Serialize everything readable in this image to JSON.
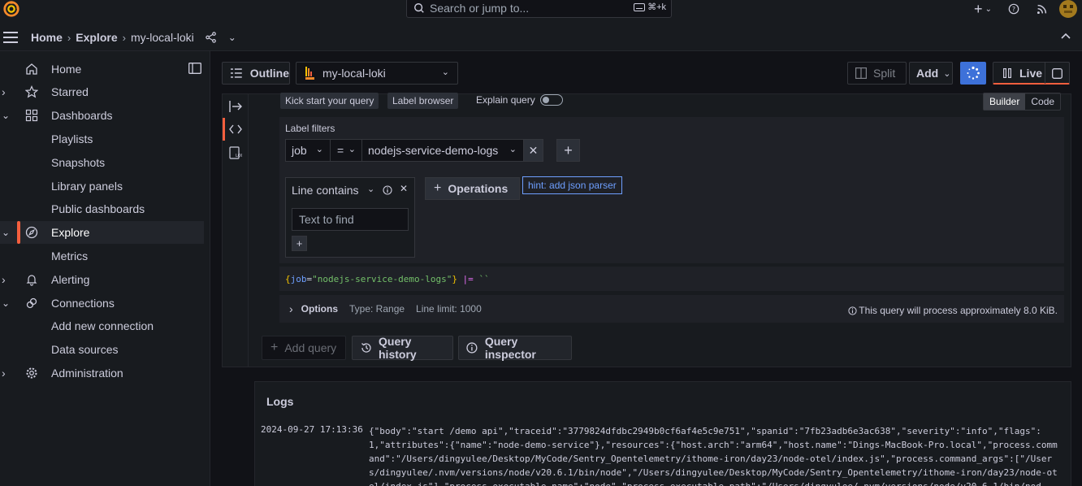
{
  "topbar": {
    "search_placeholder": "Search or jump to...",
    "search_shortcut": "⌘+k"
  },
  "breadcrumb": {
    "items": [
      "Home",
      "Explore",
      "my-local-loki"
    ]
  },
  "sidebar": {
    "items": [
      {
        "label": "Home",
        "icon": "home-icon"
      },
      {
        "label": "Starred",
        "icon": "star-icon"
      },
      {
        "label": "Dashboards",
        "icon": "apps-icon"
      },
      {
        "label": "Playlists"
      },
      {
        "label": "Snapshots"
      },
      {
        "label": "Library panels"
      },
      {
        "label": "Public dashboards"
      },
      {
        "label": "Explore",
        "icon": "compass-icon"
      },
      {
        "label": "Metrics"
      },
      {
        "label": "Alerting",
        "icon": "bell-icon"
      },
      {
        "label": "Connections",
        "icon": "link-icon"
      },
      {
        "label": "Add new connection"
      },
      {
        "label": "Data sources"
      },
      {
        "label": "Administration",
        "icon": "cog-icon"
      }
    ]
  },
  "toolbar": {
    "outline_label": "Outline",
    "datasource": "my-local-loki",
    "split_label": "Split",
    "add_label": "Add",
    "live_label": "Live"
  },
  "query": {
    "kick_start": "Kick start your query",
    "label_browser": "Label browser",
    "explain_query": "Explain query",
    "mode_builder": "Builder",
    "mode_code": "Code",
    "label_filters_title": "Label filters",
    "filter_label": "job",
    "filter_op": "=",
    "filter_value": "nodejs-service-demo-logs",
    "operation_name": "Line contains",
    "text_placeholder": "Text to find",
    "operations_label": "Operations",
    "hint": "hint: add json parser",
    "code_open": "{",
    "code_key": "job",
    "code_eq": "=",
    "code_val": "\"nodejs-service-demo-logs\"",
    "code_close": "}",
    "code_pipe": " |= ",
    "code_tail": "``",
    "options_label": "Options",
    "options_type": "Type: Range",
    "options_limit": "Line limit: 1000",
    "process_note": "This query will process approximately 8.0 KiB."
  },
  "actions": {
    "add_query": "Add query",
    "query_history": "Query history",
    "query_inspector": "Query inspector"
  },
  "logs": {
    "title": "Logs",
    "timestamp": "2024-09-27 17:13:36",
    "line": "{\"body\":\"start /demo api\",\"traceid\":\"3779824dfdbc2949b0cf6af4e5c9e751\",\"spanid\":\"7fb23adb6e3ac638\",\"severity\":\"info\",\"flags\":1,\"attributes\":{\"name\":\"node-demo-service\"},\"resources\":{\"host.arch\":\"arm64\",\"host.name\":\"Dings-MacBook-Pro.local\",\"process.command\":\"/Users/dingyulee/Desktop/MyCode/Sentry_Opentelemetry/ithome-iron/day23/node-otel/index.js\",\"process.command_args\":[\"/Users/dingyulee/.nvm/versions/node/v20.6.1/bin/node\",\"/Users/dingyulee/Desktop/MyCode/Sentry_Opentelemetry/ithome-iron/day23/node-otel/index.js\"],\"process.executable.name\":\"node\",\"process.executable.path\":\"/Users/dingyulee/.nvm/versions/node/v20.6.1/bin/nod"
  },
  "colors": {
    "accent": "#f55f3e",
    "primary": "#3d71d9",
    "hint": "#6e9fff"
  }
}
